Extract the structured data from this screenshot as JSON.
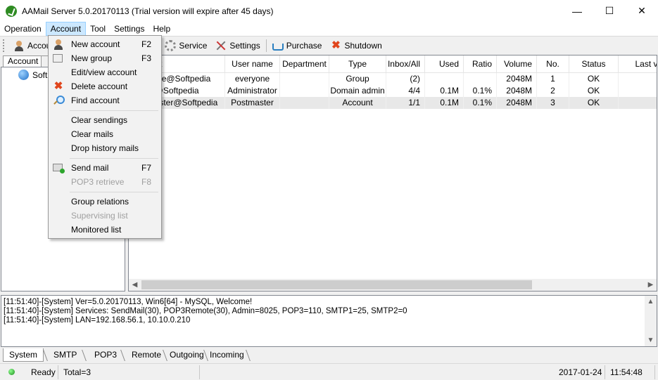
{
  "window": {
    "title": "AAMail Server 5.0.20170113 (Trial version will expire after 45 days)",
    "minimize": "—",
    "maximize": "☐",
    "close": "✕"
  },
  "menubar": [
    "Operation",
    "Account",
    "Tool",
    "Settings",
    "Help"
  ],
  "toolbar": {
    "account": "Account",
    "service": "Service",
    "settings": "Settings",
    "purchase": "Purchase",
    "shutdown": "Shutdown"
  },
  "left_panel": {
    "tab": "Account",
    "tree_root": "Softpedia"
  },
  "grid": {
    "columns": [
      "Account",
      "User name",
      "Department",
      "Type",
      "Inbox/All",
      "Used",
      "Ratio",
      "Volume",
      "No.",
      "Status",
      "Last v"
    ],
    "rows": [
      {
        "account": "everyone@Softpedia",
        "user": "everyone",
        "department": "",
        "type": "Group",
        "inbox": "(2)",
        "used": "",
        "ratio": "",
        "volume": "2048M",
        "no": "1",
        "status": "OK"
      },
      {
        "account": "admin@Softpedia",
        "user": "Administrator",
        "department": "",
        "type": "Domain admin",
        "inbox": "4/4",
        "used": "0.1M",
        "ratio": "0.1%",
        "volume": "2048M",
        "no": "2",
        "status": "OK"
      },
      {
        "account": "postmaster@Softpedia",
        "user": "Postmaster",
        "department": "",
        "type": "Account",
        "inbox": "1/1",
        "used": "0.1M",
        "ratio": "0.1%",
        "volume": "2048M",
        "no": "3",
        "status": "OK"
      }
    ]
  },
  "account_menu": {
    "new_account": "New account",
    "new_account_key": "F2",
    "new_group": "New group",
    "new_group_key": "F3",
    "edit_account": "Edit/view account",
    "delete_account": "Delete account",
    "find_account": "Find account",
    "clear_sendings": "Clear sendings",
    "clear_mails": "Clear mails",
    "drop_history": "Drop history mails",
    "send_mail": "Send mail",
    "send_mail_key": "F7",
    "pop3_retrieve": "POP3 retrieve",
    "pop3_retrieve_key": "F8",
    "group_relations": "Group relations",
    "supervising_list": "Supervising list",
    "monitored_list": "Monitored list"
  },
  "log": [
    "[11:51:40]-[System] Ver=5.0.20170113, Win6[64] - MySQL, Welcome!",
    "[11:51:40]-[System] Services: SendMail(30), POP3Remote(30), Admin=8025, POP3=110, SMTP1=25, SMTP2=0",
    "[11:51:40]-[System] LAN=192.168.56.1, 10.10.0.210"
  ],
  "bottom_tabs": [
    "System",
    "SMTP",
    "POP3",
    "Remote",
    "Outgoing",
    "Incoming"
  ],
  "statusbar": {
    "state": "Ready",
    "total": "Total=3",
    "date": "2017-01-24",
    "time": "11:54:48"
  }
}
